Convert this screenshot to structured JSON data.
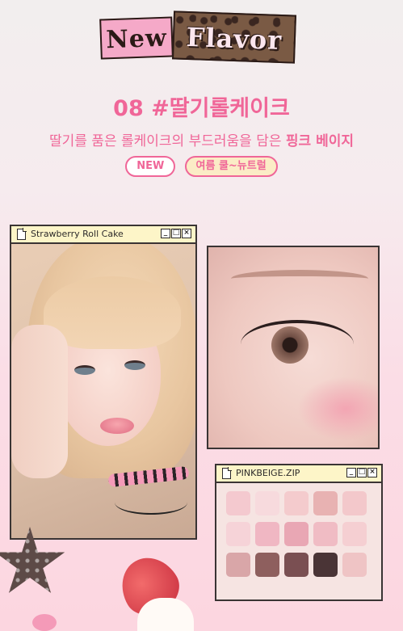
{
  "banner": {
    "tag_new": "New",
    "tag_flavor": "Flavor"
  },
  "heading": {
    "title": "08 #딸기롤케이크",
    "subtitle_pre": "딸기를 품은 롤케이크의 부드러움을 담은 ",
    "subtitle_highlight": "핑크 베이지"
  },
  "badges": {
    "new": "NEW",
    "season": "여름 쿨~뉴트럴"
  },
  "windows": {
    "main_title": "Strawberry Roll Cake",
    "palette_title": "PINKBEIGE.ZIP",
    "ctrl_min": "_",
    "ctrl_max": "□",
    "ctrl_close": "×"
  },
  "palette": {
    "pans": [
      "#f4c9cf",
      "#f7dadd",
      "#f4cbcd",
      "#e8b2b2",
      "#f3c8cb",
      "#f6d3d8",
      "#f0b7c3",
      "#e9a7b4",
      "#f0bcc4",
      "#f5cfd2",
      "#d9a6a8",
      "#8e5f5e",
      "#7a4f52",
      "#4a3436",
      "#efc4c5"
    ]
  }
}
